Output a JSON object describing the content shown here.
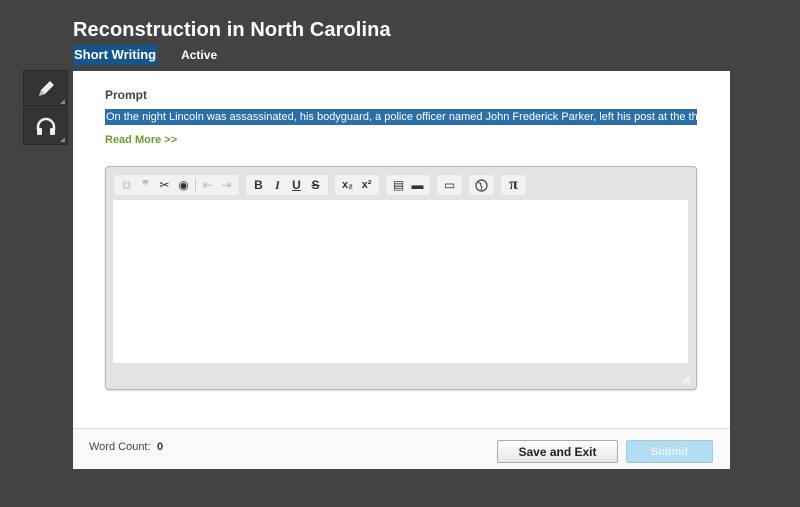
{
  "header": {
    "title": "Reconstruction in North Carolina",
    "activity_type": "Short Writing",
    "status": "Active"
  },
  "side_tools": [
    {
      "icon": "pencil-icon",
      "label": "Annotate"
    },
    {
      "icon": "headphones-icon",
      "label": "Listen"
    }
  ],
  "prompt": {
    "label": "Prompt",
    "text": "On the night Lincoln was assassinated, his bodyguard, a police officer named John Frederick Parker, left his post at the theater",
    "read_more": "Read More >>"
  },
  "editor": {
    "toolbar": {
      "copy": "⧉",
      "quote": "❞",
      "cut": "✂",
      "special": "◉",
      "outdent": "⇤",
      "indent": "⇥",
      "bold": "B",
      "italic": "I",
      "underline": "U",
      "strike": "S",
      "subscript": "x₂",
      "superscript": "x²",
      "table": "▤",
      "hline": "▬",
      "textbox": "▭",
      "globe": "🌐",
      "pi": "π"
    },
    "content": ""
  },
  "footer": {
    "word_count_label": "Word Count:",
    "word_count_value": "0",
    "save_label": "Save and Exit",
    "submit_label": "Submit"
  }
}
